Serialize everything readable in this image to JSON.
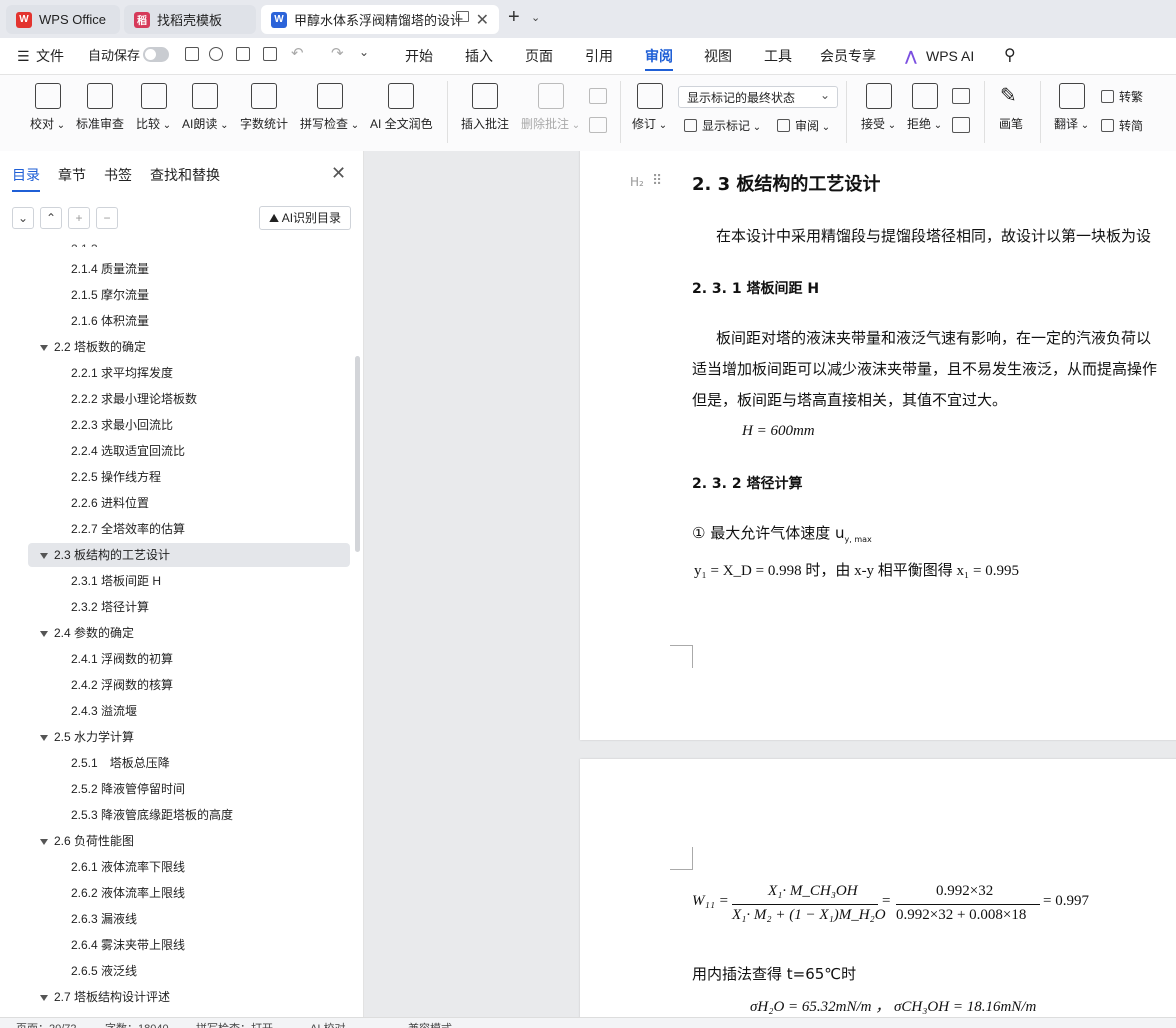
{
  "tabs": [
    {
      "label": "WPS Office"
    },
    {
      "label": "找稻壳模板"
    },
    {
      "label": "甲醇水体系浮阀精馏塔的设计"
    }
  ],
  "new_tab": "+",
  "menu": {
    "file": "文件",
    "autosave": "自动保存",
    "items": [
      "开始",
      "插入",
      "页面",
      "引用",
      "审阅",
      "视图",
      "工具",
      "会员专享"
    ],
    "active": "审阅",
    "wps_ai": "WPS AI"
  },
  "ribbon": {
    "proofread": "校对",
    "standard_review": "标准审查",
    "compare": "比较",
    "ai_read": "AI朗读",
    "word_count": "字数统计",
    "spell_check": "拼写检查",
    "ai_polish": "AI 全文润色",
    "insert_comment": "插入批注",
    "delete_comment": "删除批注",
    "revise": "修订",
    "display_select": "显示标记的最终状态",
    "show_markup": "显示标记",
    "review": "审阅",
    "accept": "接受",
    "reject": "拒绝",
    "pen": "画笔",
    "translate": "翻译",
    "to_traditional": "转繁",
    "to_simplified": "转简"
  },
  "pane": {
    "tabs": [
      "目录",
      "章节",
      "书签",
      "查找和替换"
    ],
    "ai_button": "AI识别目录",
    "outline": [
      {
        "label": "2.1.4 质量流量",
        "level": 3
      },
      {
        "label": "2.1.5 摩尔流量",
        "level": 3
      },
      {
        "label": "2.1.6 体积流量",
        "level": 3
      },
      {
        "label": "2.2 塔板数的确定",
        "level": 2
      },
      {
        "label": "2.2.1 求平均挥发度",
        "level": 3
      },
      {
        "label": "2.2.2 求最小理论塔板数",
        "level": 3
      },
      {
        "label": "2.2.3 求最小回流比",
        "level": 3
      },
      {
        "label": "2.2.4 选取适宜回流比",
        "level": 3
      },
      {
        "label": "2.2.5 操作线方程",
        "level": 3
      },
      {
        "label": "2.2.6 进料位置",
        "level": 3
      },
      {
        "label": "2.2.7 全塔效率的估算",
        "level": 3
      },
      {
        "label": "2.3 板结构的工艺设计",
        "level": 2
      },
      {
        "label": "2.3.1 塔板间距 H",
        "level": 3
      },
      {
        "label": "2.3.2 塔径计算",
        "level": 3
      },
      {
        "label": "2.4 参数的确定",
        "level": 2
      },
      {
        "label": "2.4.1 浮阀数的初算",
        "level": 3
      },
      {
        "label": "2.4.2 浮阀数的核算",
        "level": 3
      },
      {
        "label": "2.4.3 溢流堰",
        "level": 3
      },
      {
        "label": "2.5 水力学计算",
        "level": 2
      },
      {
        "label": "2.5.1　塔板总压降",
        "level": 3
      },
      {
        "label": "2.5.2 降液管停留时间",
        "level": 3
      },
      {
        "label": "2.5.3 降液管底缘距塔板的高度",
        "level": 3
      },
      {
        "label": "2.6 负荷性能图",
        "level": 2
      },
      {
        "label": "2.6.1 液体流率下限线",
        "level": 3
      },
      {
        "label": "2.6.2 液体流率上限线",
        "level": 3
      },
      {
        "label": "2.6.3 漏液线",
        "level": 3
      },
      {
        "label": "2.6.4 雾沫夹带上限线",
        "level": 3
      },
      {
        "label": "2.6.5 液泛线",
        "level": 3
      },
      {
        "label": "2.7 塔板结构设计评述",
        "level": 2
      }
    ],
    "selected": "2.3 板结构的工艺设计"
  },
  "doc": {
    "h2_marker": "H₂",
    "heading": "2. 3 板结构的工艺设计",
    "para1": "在本设计中采用精馏段与提馏段塔径相同，故设计以第一块板为设",
    "h3_1": "2. 3. 1 塔板间距 H",
    "para2_l1": "板间距对塔的液沫夹带量和液泛气速有影响，在一定的汽液负荷以",
    "para2_l2": "适当增加板间距可以减少液沫夹带量，且不易发生液泛，从而提高操作",
    "para2_l3": "但是，板间距与塔高直接相关，其值不宜过大。",
    "formula_h": "H = 600mm",
    "h3_2": "2. 3. 2 塔径计算",
    "item1": "① 最大允许气体速度 u",
    "item1_sub": "y, max",
    "line_y": "y₁ = X_D = 0.998 时，由 x-y 相平衡图得 x₁ = 0.995",
    "eq_lhs": "W₁₁ =",
    "eq_num1": "X₁· M_CH₃OH",
    "eq_den1": "X₁· M₂ + (1 − X₁)M_H₂O",
    "eq_num2": "0.992×32",
    "eq_den2": "0.992×32 + 0.008×18",
    "eq_result": "= 0.997",
    "interp": "用内插法查得 t=65℃时",
    "sigma": "σH₂O = 65.32mN/m ，  σCH₃OH = 18.16mN/m"
  },
  "status": {
    "page": "页面：20/72",
    "words": "字数：18040",
    "spell": "拼写检查：打开",
    "ai_check": "AI 校对",
    "compat": "兼容模式"
  }
}
